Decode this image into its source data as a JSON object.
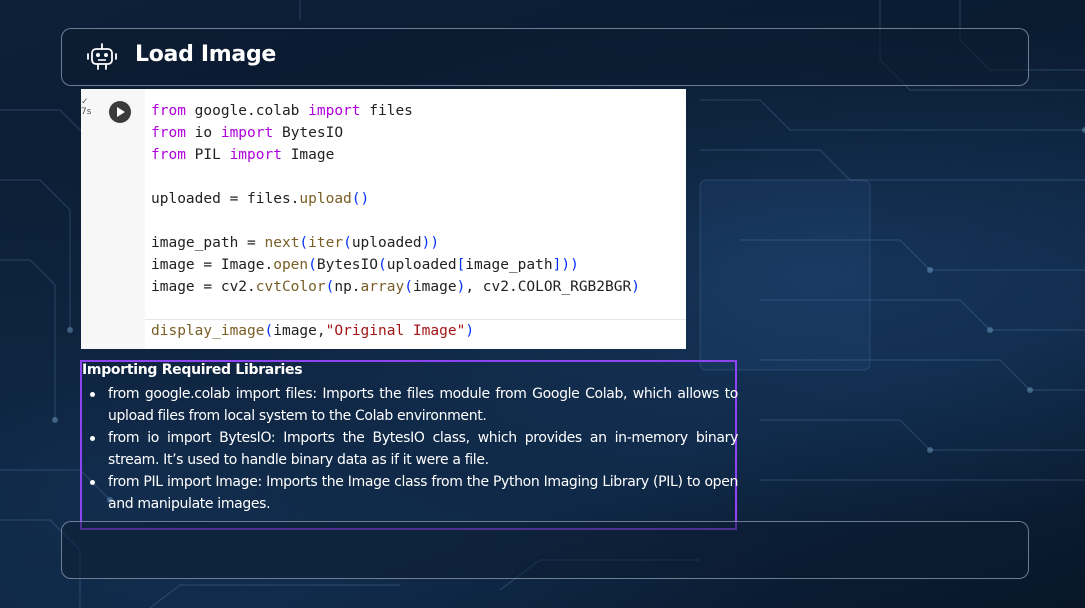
{
  "header": {
    "title": "Load Image",
    "icon": "robot-icon"
  },
  "code_cell": {
    "gutter_mark": "✓\n7s",
    "lines": [
      "from google.colab import files",
      "from io import BytesIO",
      "from PIL import Image",
      "",
      "uploaded = files.upload()",
      "",
      "image_path = next(iter(uploaded))",
      "image = Image.open(BytesIO(uploaded[image_path]))",
      "image = cv2.cvtColor(np.array(image), cv2.COLOR_RGB2BGR)",
      "",
      "display_image(image,\"Original Image\")"
    ]
  },
  "description": {
    "title": "Importing Required Libraries",
    "items": [
      "from google.colab import files: Imports the files module from Google Colab, which allows to upload files from local system to the Colab environment.",
      "from io import BytesIO: Imports the BytesIO class, which provides an in-memory binary stream. It’s used to handle binary data as if it were a file.",
      "from PIL import Image: Imports the Image class from the Python Imaging Library (PIL) to open and manipulate images."
    ]
  },
  "colors": {
    "accent_border": "#8e44f0",
    "keyword": "#af00db",
    "function": "#795e26",
    "string": "#a31515"
  }
}
